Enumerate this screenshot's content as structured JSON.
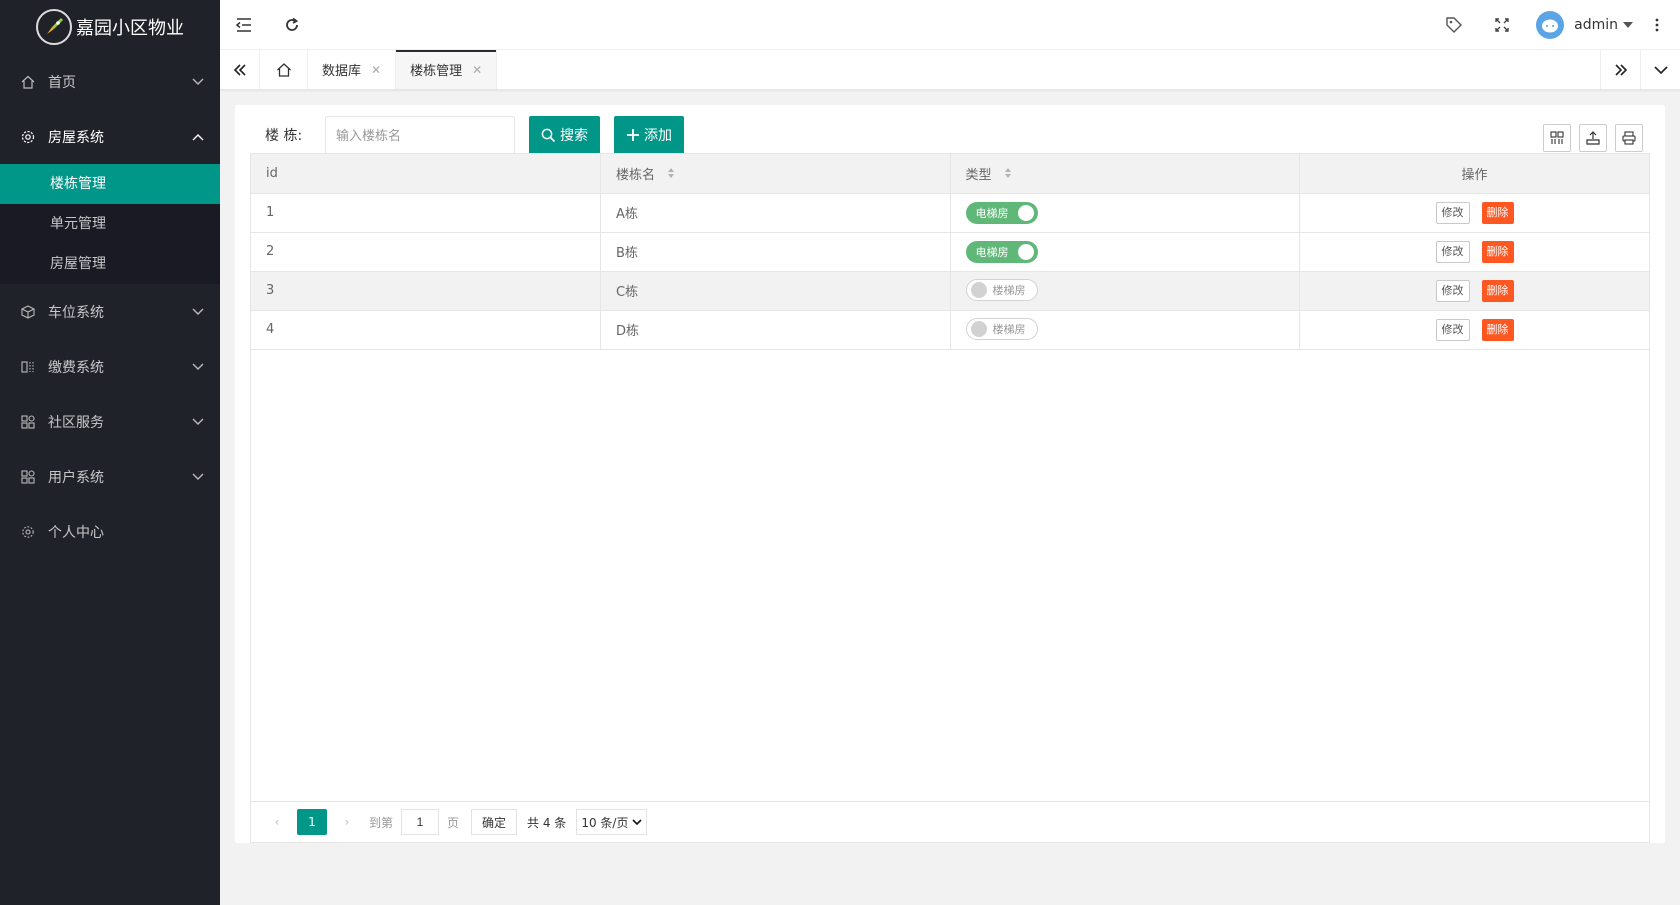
{
  "app": {
    "title": "嘉园小区物业"
  },
  "sidebar": {
    "items": [
      {
        "label": "首页",
        "icon": "home-icon",
        "has_arrow": true
      },
      {
        "label": "房屋系统",
        "icon": "gear-icon",
        "has_arrow": true,
        "open": true,
        "children": [
          {
            "label": "楼栋管理",
            "active": true
          },
          {
            "label": "单元管理"
          },
          {
            "label": "房屋管理"
          }
        ]
      },
      {
        "label": "车位系统",
        "icon": "cube-icon",
        "has_arrow": true
      },
      {
        "label": "缴费系统",
        "icon": "component-icon",
        "has_arrow": true
      },
      {
        "label": "社区服务",
        "icon": "apps-icon",
        "has_arrow": true
      },
      {
        "label": "用户系统",
        "icon": "apps-icon",
        "has_arrow": true
      },
      {
        "label": "个人中心",
        "icon": "settings-icon",
        "has_arrow": false
      }
    ]
  },
  "header": {
    "user": "admin"
  },
  "tabs": [
    {
      "label": "数据库",
      "active": false
    },
    {
      "label": "楼栋管理",
      "active": true
    }
  ],
  "toolbar": {
    "label": "楼 栋:",
    "search_placeholder": "输入楼栋名",
    "search_button": "搜索",
    "add_button": "添加"
  },
  "table": {
    "columns": [
      "id",
      "楼栋名",
      "类型",
      "操作"
    ],
    "rows": [
      {
        "id": "1",
        "name": "A栋",
        "type": "电梯房",
        "type_on": true
      },
      {
        "id": "2",
        "name": "B栋",
        "type": "电梯房",
        "type_on": true
      },
      {
        "id": "3",
        "name": "C栋",
        "type": "楼梯房",
        "type_on": false
      },
      {
        "id": "4",
        "name": "D栋",
        "type": "楼梯房",
        "type_on": false
      }
    ],
    "edit_label": "修改",
    "delete_label": "删除"
  },
  "pager": {
    "current": "1",
    "goto_label": "到第",
    "goto_value": "1",
    "page_unit": "页",
    "confirm": "确定",
    "total": "共 4 条",
    "page_size": "10 条/页"
  },
  "colors": {
    "primary": "#009688",
    "sidebar": "#20222a",
    "danger": "#ff5722",
    "switch_on": "#5fb878"
  }
}
